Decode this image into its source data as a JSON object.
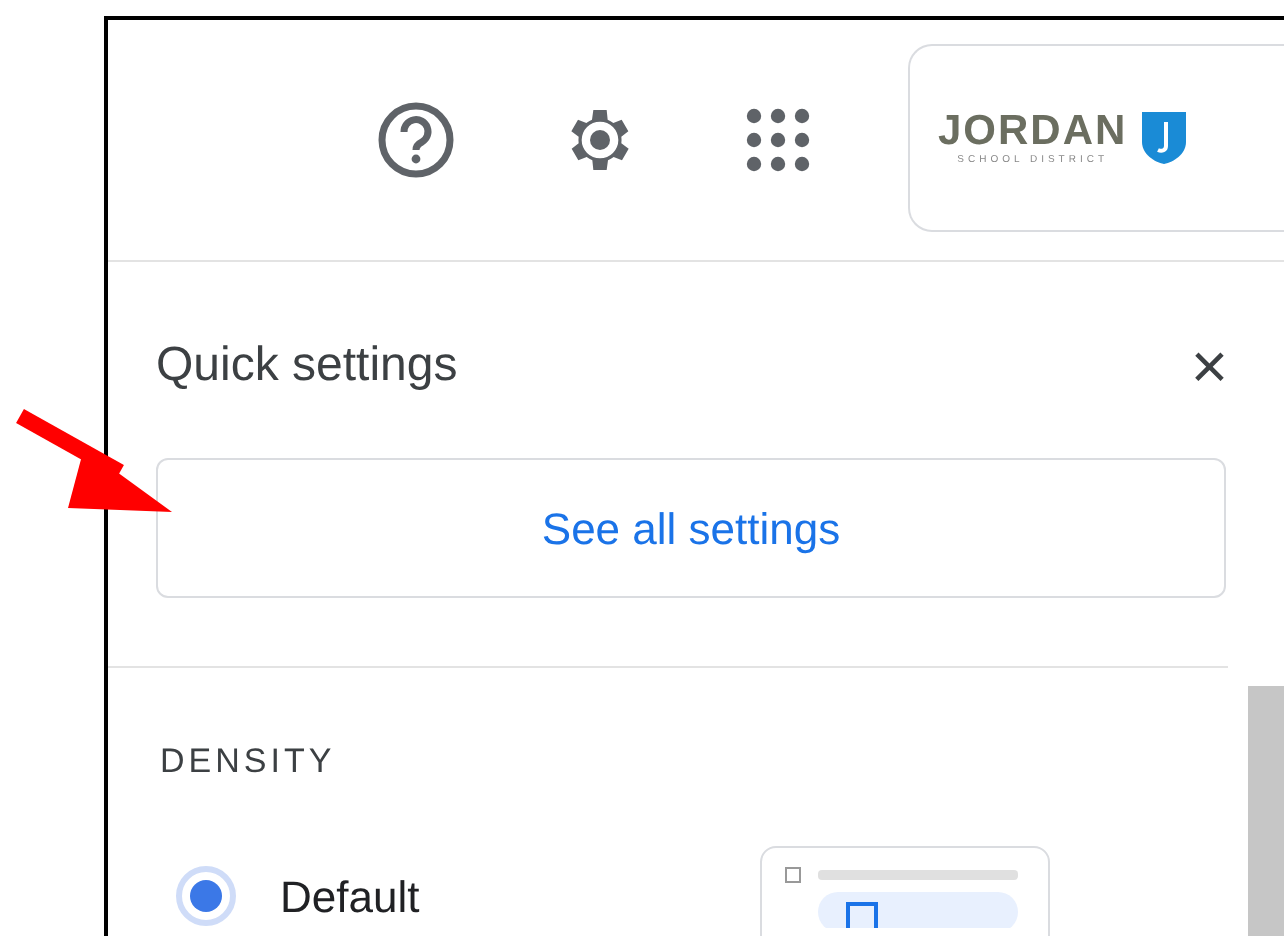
{
  "logo": {
    "name": "JORDAN",
    "tagline": "SCHOOL DISTRICT"
  },
  "quick_settings": {
    "title": "Quick settings",
    "close": "×",
    "see_all_button": "See all settings",
    "density": {
      "heading": "DENSITY",
      "options": [
        {
          "label": "Default",
          "selected": true
        }
      ]
    }
  }
}
